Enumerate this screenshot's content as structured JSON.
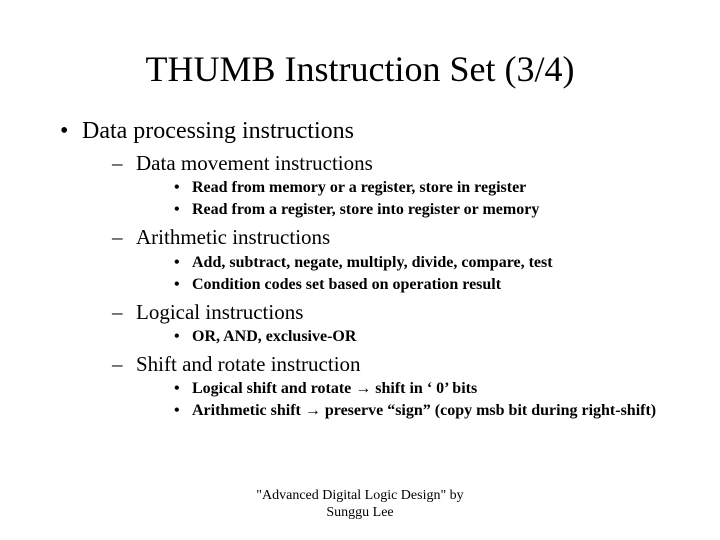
{
  "title": "THUMB Instruction Set (3/4)",
  "bullets": {
    "l1": "Data processing instructions",
    "l2a": "Data movement instructions",
    "l3a1": "Read from memory or a register, store in register",
    "l3a2": "Read from a register, store into register or memory",
    "l2b": "Arithmetic instructions",
    "l3b1": "Add, subtract, negate, multiply, divide, compare, test",
    "l3b2": "Condition codes set based on operation result",
    "l2c": "Logical instructions",
    "l3c1": "OR, AND, exclusive-OR",
    "l2d": "Shift and rotate instruction",
    "l3d1": "Logical shift and rotate → shift in ‘ 0’ bits",
    "l3d2": "Arithmetic shift → preserve “sign” (copy msb bit during right-shift)"
  },
  "footer_line1": "\"Advanced Digital Logic Design\" by",
  "footer_line2": "Sunggu Lee"
}
